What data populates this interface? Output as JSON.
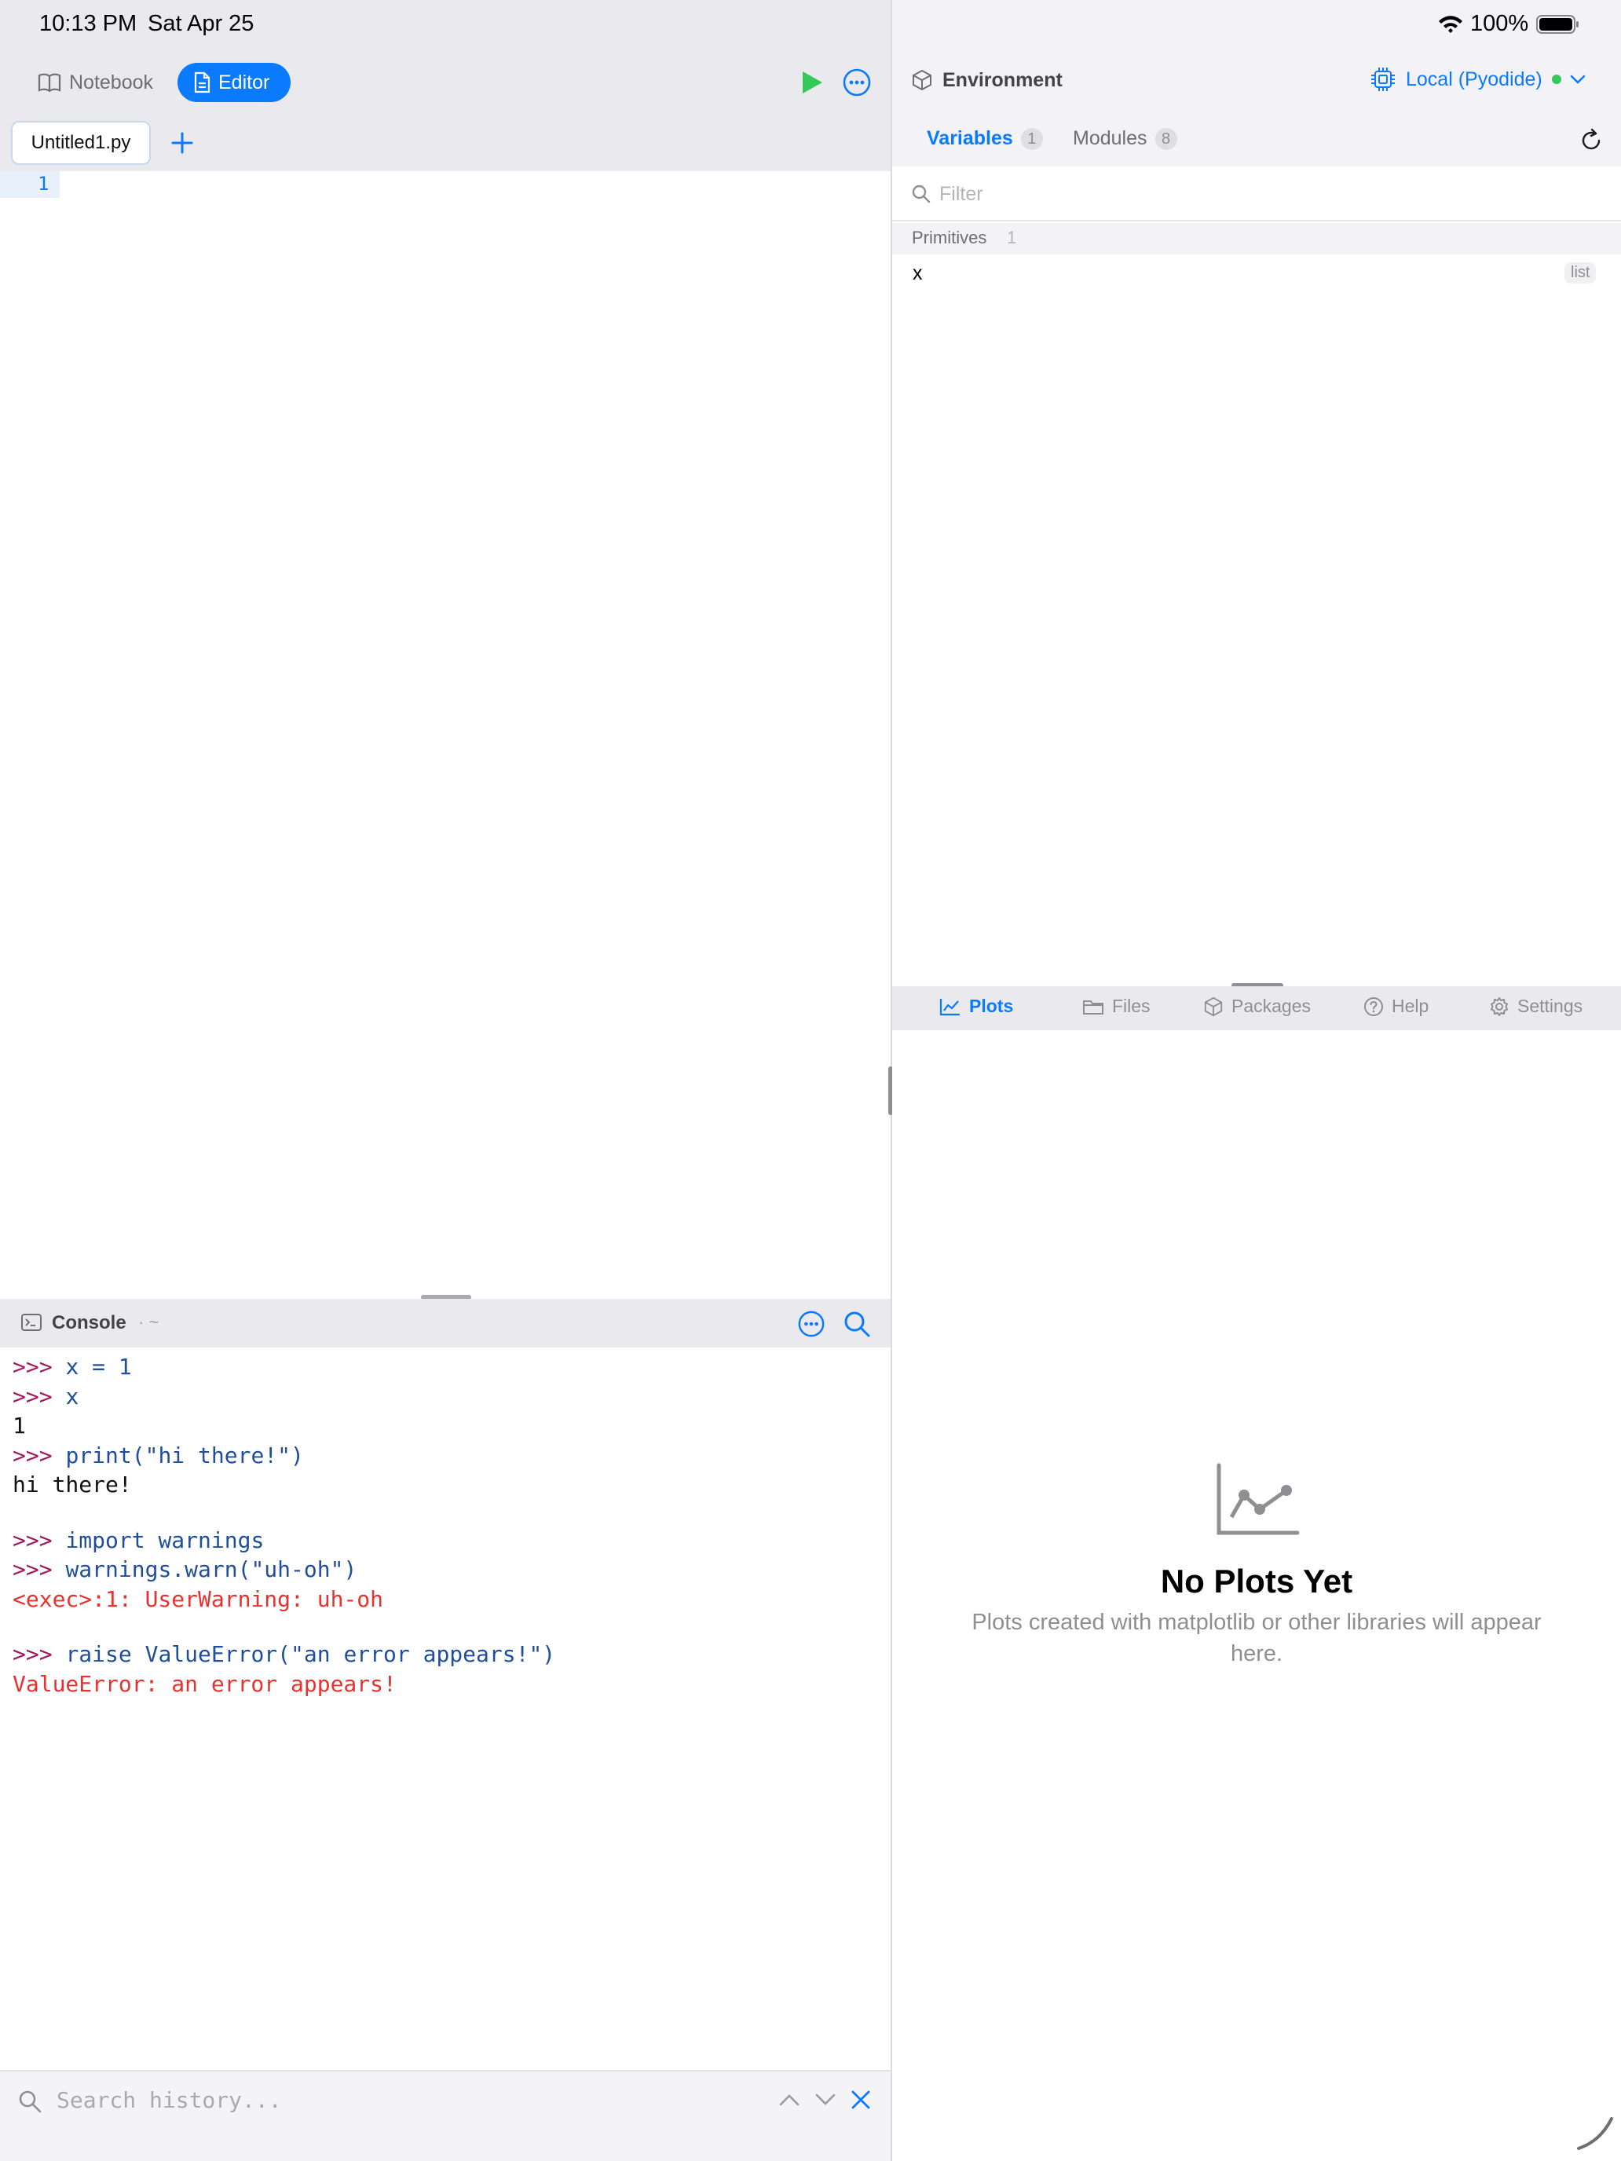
{
  "status": {
    "time": "10:13 PM",
    "date": "Sat Apr 25",
    "battery": "100%"
  },
  "editor": {
    "segments": {
      "notebook": "Notebook",
      "editor": "Editor"
    },
    "file_tab": "Untitled1.py",
    "line_number": "1"
  },
  "console": {
    "title": "Console",
    "path": "· ~",
    "lines": [
      {
        "kind": "input",
        "prompt": ">>> ",
        "text": "x = 1"
      },
      {
        "kind": "input",
        "prompt": ">>> ",
        "text": "x"
      },
      {
        "kind": "output",
        "text": "1"
      },
      {
        "kind": "input",
        "prompt": ">>> ",
        "text": "print(\"hi there!\")"
      },
      {
        "kind": "output",
        "text": "hi there!"
      },
      {
        "kind": "input",
        "prompt": ">>> ",
        "text": "import warnings",
        "gap": true
      },
      {
        "kind": "input",
        "prompt": ">>> ",
        "text": "warnings.warn(\"uh-oh\")"
      },
      {
        "kind": "error",
        "text": "<exec>:1: UserWarning: uh-oh"
      },
      {
        "kind": "input",
        "prompt": ">>> ",
        "text": "raise ValueError(\"an error appears!\")",
        "gap": true
      },
      {
        "kind": "error",
        "text": "ValueError: an error appears!"
      }
    ],
    "history_placeholder": "Search history..."
  },
  "environment": {
    "title": "Environment",
    "runtime": "Local (Pyodide)",
    "tabs": {
      "variables": {
        "label": "Variables",
        "count": "1"
      },
      "modules": {
        "label": "Modules",
        "count": "8"
      }
    },
    "filter_placeholder": "Filter",
    "group": {
      "label": "Primitives",
      "count": "1"
    },
    "variables": [
      {
        "name": "x",
        "type": "list"
      }
    ]
  },
  "bottom_tabs": {
    "plots": "Plots",
    "files": "Files",
    "packages": "Packages",
    "help": "Help",
    "settings": "Settings"
  },
  "plots": {
    "empty_title": "No Plots Yet",
    "empty_desc": "Plots created with matplotlib or other libraries will appear here."
  },
  "colors": {
    "accent": "#0a7aff",
    "run": "#34c759",
    "prompt": "#a1185e",
    "code": "#1f4e9c",
    "error": "#e8322f"
  }
}
